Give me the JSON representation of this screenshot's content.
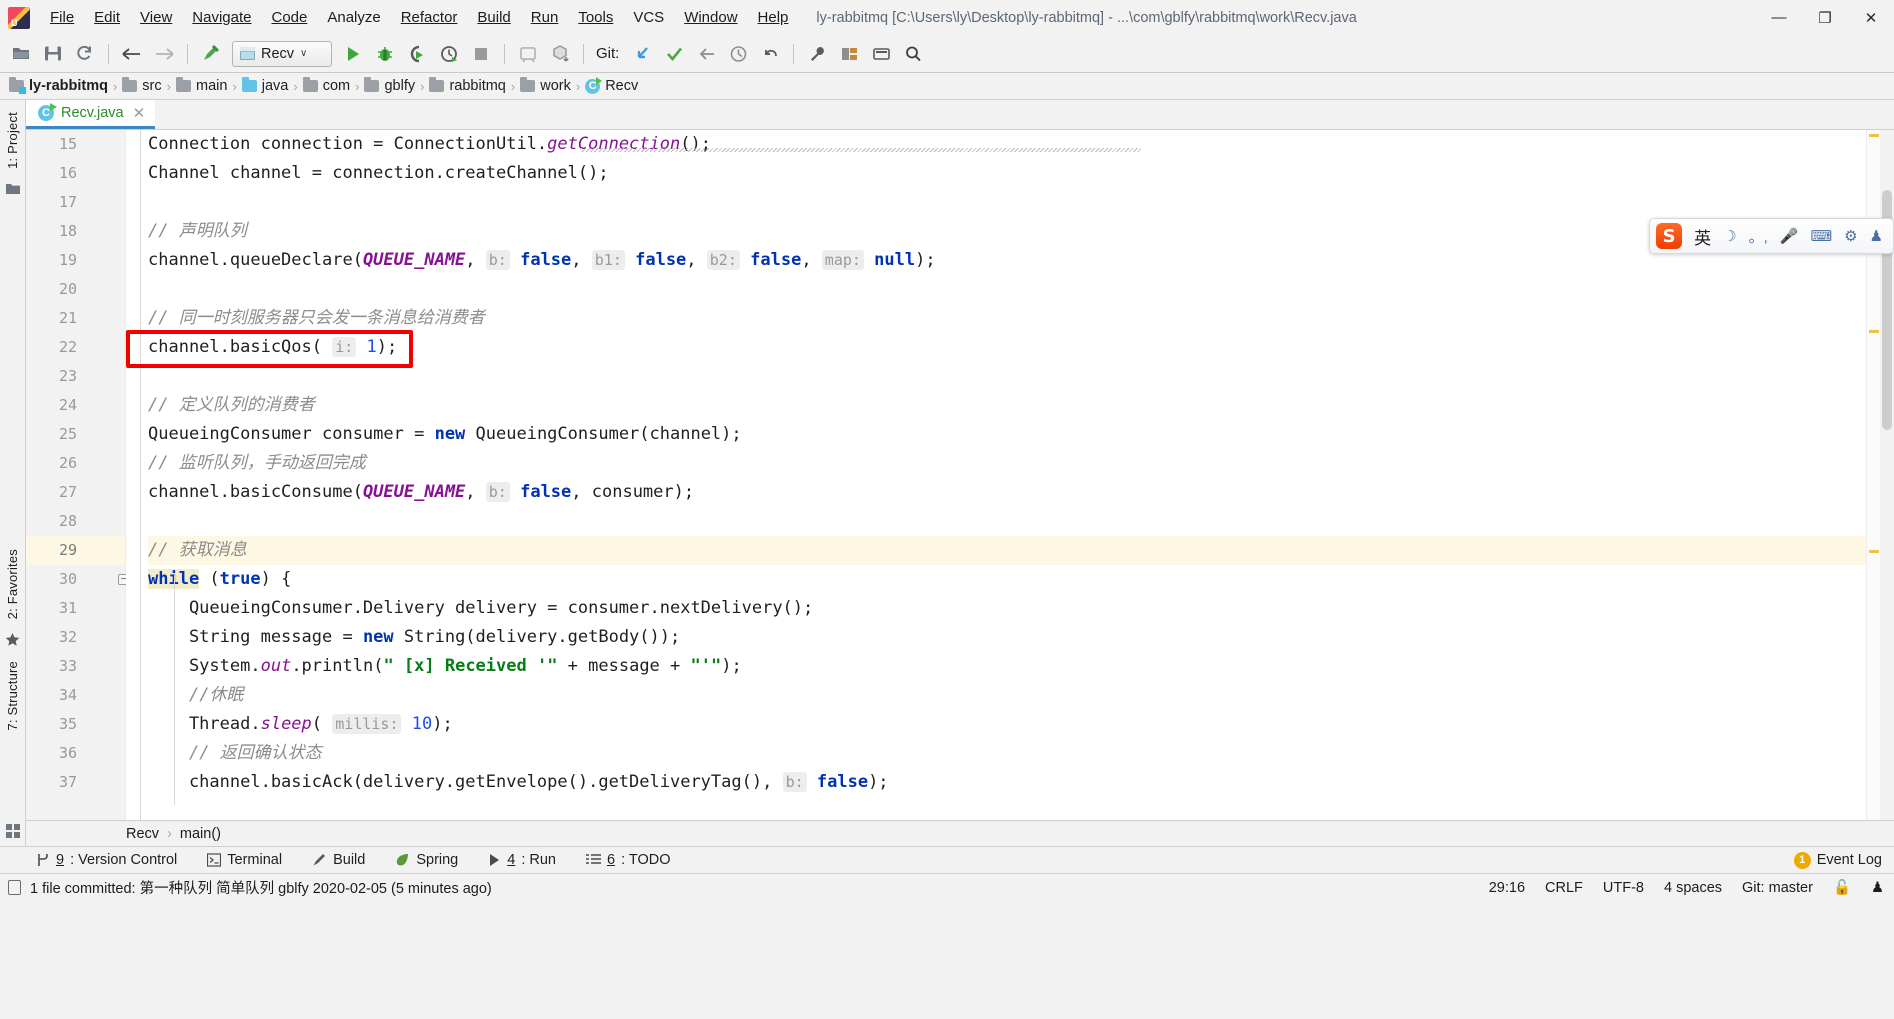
{
  "window": {
    "title": "ly-rabbitmq [C:\\Users\\ly\\Desktop\\ly-rabbitmq] - ...\\com\\gblfy\\rabbitmq\\work\\Recv.java",
    "minimize": "—",
    "maximize": "❐",
    "close": "✕"
  },
  "menu": [
    {
      "label": "File"
    },
    {
      "label": "Edit"
    },
    {
      "label": "View"
    },
    {
      "label": "Navigate"
    },
    {
      "label": "Code"
    },
    {
      "label": "Analyze"
    },
    {
      "label": "Refactor"
    },
    {
      "label": "Build"
    },
    {
      "label": "Run"
    },
    {
      "label": "Tools"
    },
    {
      "label": "VCS"
    },
    {
      "label": "Window"
    },
    {
      "label": "Help"
    }
  ],
  "toolbar": {
    "run_config": "Recv",
    "git_label": "Git:",
    "caret": "∨"
  },
  "breadcrumb": [
    {
      "label": "ly-rabbitmq",
      "kind": "project"
    },
    {
      "label": "src",
      "kind": "folder"
    },
    {
      "label": "main",
      "kind": "folder"
    },
    {
      "label": "java",
      "kind": "source"
    },
    {
      "label": "com",
      "kind": "folder"
    },
    {
      "label": "gblfy",
      "kind": "folder"
    },
    {
      "label": "rabbitmq",
      "kind": "folder"
    },
    {
      "label": "work",
      "kind": "folder"
    },
    {
      "label": "Recv",
      "kind": "class"
    }
  ],
  "breadcrumb_sep": "›",
  "left_rail": {
    "project": "1: Project",
    "favorites": "2: Favorites",
    "structure": "7: Structure"
  },
  "tabs": [
    {
      "label": "Recv.java",
      "close": "✕",
      "active": true
    }
  ],
  "editor": {
    "current_line": 29,
    "lines": [
      {
        "n": 15,
        "html": "Connection connection = ConnectionUtil.<span class=\"stat\">getConnection</span>();"
      },
      {
        "n": 16,
        "html": "Channel channel = connection.createChannel();"
      },
      {
        "n": 17,
        "html": ""
      },
      {
        "n": 18,
        "html": "<span class=\"cmt\">// 声明队列</span>"
      },
      {
        "n": 19,
        "html": "channel.queueDeclare(<span class=\"cnst\">QUEUE_NAME</span>, <span class=\"hint\">b:</span> <span class=\"kw\">false</span>, <span class=\"hint\">b1:</span> <span class=\"kw\">false</span>, <span class=\"hint\">b2:</span> <span class=\"kw\">false</span>, <span class=\"hint\">map:</span> <span class=\"kw\">null</span>);"
      },
      {
        "n": 20,
        "html": ""
      },
      {
        "n": 21,
        "html": "<span class=\"cmt\">// 同一时刻服务器只会发一条消息给消费者</span>"
      },
      {
        "n": 22,
        "html": "channel.basicQos( <span class=\"hint\">i:</span> <span class=\"num\">1</span>);"
      },
      {
        "n": 23,
        "html": ""
      },
      {
        "n": 24,
        "html": "<span class=\"cmt\">// 定义队列的消费者</span>"
      },
      {
        "n": 25,
        "html": "QueueingConsumer consumer = <span class=\"kw\">new</span> QueueingConsumer(channel);"
      },
      {
        "n": 26,
        "html": "<span class=\"cmt\">// 监听队列，手动返回完成</span>"
      },
      {
        "n": 27,
        "html": "channel.basicConsume(<span class=\"cnst\">QUEUE_NAME</span>, <span class=\"hint\">b:</span> <span class=\"kw\">false</span>, consumer);"
      },
      {
        "n": 28,
        "html": ""
      },
      {
        "n": 29,
        "html": "<span class=\"cmt\">// 获取消息</span>"
      },
      {
        "n": 30,
        "html": "<span class=\"kw kwhl\">while</span> (<span class=\"kw\">true</span>) {"
      },
      {
        "n": 31,
        "html": "    QueueingConsumer.Delivery delivery = consumer.nextDelivery();"
      },
      {
        "n": 32,
        "html": "    String message = <span class=\"kw\">new</span> String(delivery.getBody());"
      },
      {
        "n": 33,
        "html": "    System.<span class=\"stat\">out</span>.println(<span class=\"str\">\" [x] Received '\"</span> + message + <span class=\"str\">\"'\"</span>);"
      },
      {
        "n": 34,
        "html": "    <span class=\"cmt\">//休眠</span>"
      },
      {
        "n": 35,
        "html": "    Thread.<span class=\"stat\">sleep</span>( <span class=\"hint\">millis:</span> <span class=\"num\">10</span>);"
      },
      {
        "n": 36,
        "html": "    <span class=\"cmt\">// 返回确认状态</span>"
      },
      {
        "n": 37,
        "html": "    channel.basicAck(delivery.getEnvelope().getDeliveryTag(), <span class=\"hint\">b:</span> <span class=\"kw\">false</span>);"
      }
    ],
    "annotation": {
      "label": "red-highlight-box",
      "target_line": 22
    }
  },
  "ime": {
    "logo": "S",
    "mode": "英",
    "moon": "☽",
    "punct": "。,",
    "mic": "🎤",
    "keyboard": "⌨",
    "toolbox": "⚙",
    "hat": "♟"
  },
  "method_crumb": {
    "class": "Recv",
    "method": "main()",
    "sep": "›"
  },
  "toolwindows": [
    {
      "num": "9",
      "label": ": Version Control",
      "icon": "branch-icon"
    },
    {
      "num": "",
      "label": "Terminal",
      "icon": "terminal-icon"
    },
    {
      "num": "",
      "label": "Build",
      "icon": "hammer-icon"
    },
    {
      "num": "",
      "label": "Spring",
      "icon": "leaf-icon"
    },
    {
      "num": "4",
      "label": ": Run",
      "icon": "play-icon"
    },
    {
      "num": "6",
      "label": ": TODO",
      "icon": "list-icon"
    }
  ],
  "event_log": {
    "count": "1",
    "label": "Event Log"
  },
  "statusbar": {
    "message": "1 file committed: 第一种队列 简单队列 gblfy 2020-02-05 (5 minutes ago)",
    "caret_position": "29:16",
    "line_separator": "CRLF",
    "encoding": "UTF-8",
    "indent": "4 spaces",
    "git_branch": "Git: master",
    "lock": "🔓",
    "inspector": "♟"
  },
  "colors": {
    "accent_blue": "#3c87c8",
    "keyword": "#0033b3",
    "string": "#067d17",
    "comment": "#8c8c8c",
    "static": "#871094",
    "number": "#1750eb",
    "highlight_box": "#f20000",
    "current_line": "#fdf7e4",
    "chrome": "#f2f2f2"
  }
}
